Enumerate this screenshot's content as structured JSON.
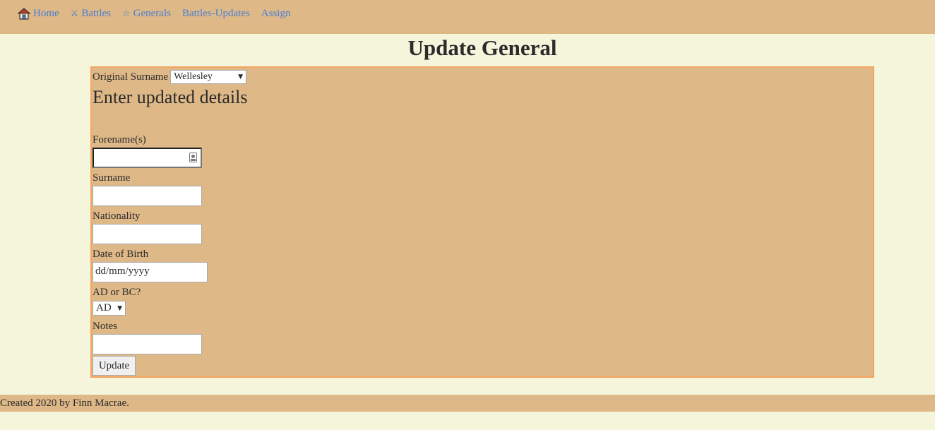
{
  "nav": {
    "items": [
      {
        "label": "Home",
        "icon": "home-icon"
      },
      {
        "label": "Battles",
        "icon": "crossed-swords-icon"
      },
      {
        "label": "Generals",
        "icon": "star-icon"
      },
      {
        "label": "Battles-Updates",
        "icon": ""
      },
      {
        "label": "Assign",
        "icon": ""
      }
    ],
    "link_color": "#4a7fd6"
  },
  "page": {
    "title": "Update General",
    "background": "#f5f5dc",
    "panel_color": "#deb887",
    "panel_border_color": "#f4a460"
  },
  "form": {
    "original_surname_label": "Original Surname",
    "original_surname_value": "Wellesley",
    "subheading": "Enter updated details",
    "forename_label": "Forename(s)",
    "forename_value": "",
    "surname_label": "Surname",
    "surname_value": "",
    "nationality_label": "Nationality",
    "nationality_value": "",
    "dob_label": "Date of Birth",
    "dob_placeholder": "dd/mm/yyyy",
    "era_label": "AD or BC?",
    "era_value": "AD",
    "notes_label": "Notes",
    "notes_value": "",
    "submit_label": "Update"
  },
  "footer": {
    "text": "Created 2020 by Finn Macrae."
  }
}
